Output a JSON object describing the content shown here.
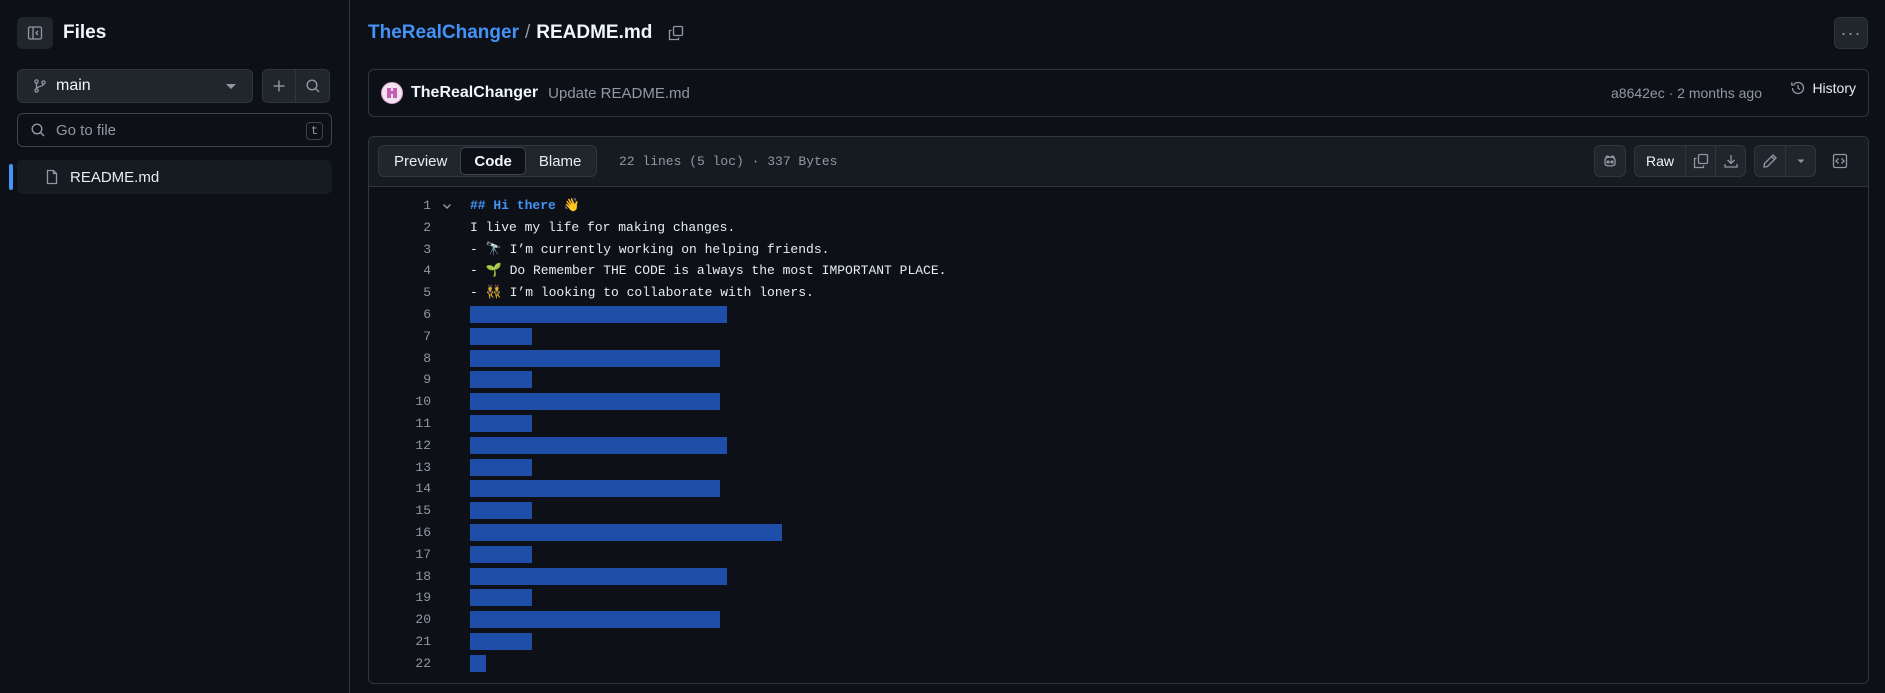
{
  "sidebar": {
    "title": "Files",
    "branch": "main",
    "search_placeholder": "Go to file",
    "search_shortcut": "t",
    "files": [
      {
        "name": "README.md"
      }
    ]
  },
  "breadcrumb": {
    "repo": "TheRealChanger",
    "separator": "/",
    "file": "README.md"
  },
  "more_label": "···",
  "commit": {
    "author": "TheRealChanger",
    "message": "Update README.md",
    "meta": "a8642ec · 2 months ago",
    "history_label": "History"
  },
  "viewer": {
    "tabs": [
      "Preview",
      "Code",
      "Blame"
    ],
    "active_tab": "Code",
    "file_info": "22 lines (5 loc) · 337 Bytes",
    "raw_label": "Raw"
  },
  "colors": {
    "accent": "#4493f8",
    "selection": "#1f4ea8",
    "background": "#0d1117"
  },
  "code_lines": [
    {
      "n": "1",
      "text": "## Hi there 👋",
      "heading": true
    },
    {
      "n": "2",
      "text": "I live my life for making changes."
    },
    {
      "n": "3",
      "text": "- 🔭 I’m currently working on helping friends."
    },
    {
      "n": "4",
      "text": "- 🌱 Do Remember THE CODE is always the most IMPORTANT PLACE."
    },
    {
      "n": "5",
      "text": "- 👯 I’m looking to collaborate with loners."
    },
    {
      "n": "6",
      "selected_chars": 33
    },
    {
      "n": "7",
      "selected_chars": 8
    },
    {
      "n": "8",
      "selected_chars": 32
    },
    {
      "n": "9",
      "selected_chars": 8
    },
    {
      "n": "10",
      "selected_chars": 32
    },
    {
      "n": "11",
      "selected_chars": 8
    },
    {
      "n": "12",
      "selected_chars": 33
    },
    {
      "n": "13",
      "selected_chars": 8
    },
    {
      "n": "14",
      "selected_chars": 32
    },
    {
      "n": "15",
      "selected_chars": 8
    },
    {
      "n": "16",
      "selected_chars": 40
    },
    {
      "n": "17",
      "selected_chars": 8
    },
    {
      "n": "18",
      "selected_chars": 33
    },
    {
      "n": "19",
      "selected_chars": 8
    },
    {
      "n": "20",
      "selected_chars": 32
    },
    {
      "n": "21",
      "selected_chars": 8
    },
    {
      "n": "22",
      "selected_chars": 2
    }
  ]
}
